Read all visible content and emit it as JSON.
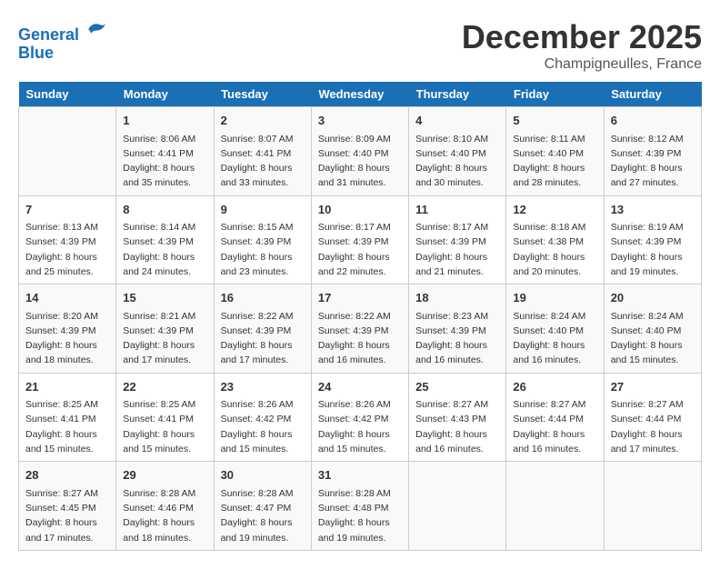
{
  "header": {
    "logo_line1": "General",
    "logo_line2": "Blue",
    "month": "December 2025",
    "location": "Champigneulles, France"
  },
  "days_of_week": [
    "Sunday",
    "Monday",
    "Tuesday",
    "Wednesday",
    "Thursday",
    "Friday",
    "Saturday"
  ],
  "weeks": [
    [
      {
        "day": "",
        "info": ""
      },
      {
        "day": "1",
        "info": "Sunrise: 8:06 AM\nSunset: 4:41 PM\nDaylight: 8 hours\nand 35 minutes."
      },
      {
        "day": "2",
        "info": "Sunrise: 8:07 AM\nSunset: 4:41 PM\nDaylight: 8 hours\nand 33 minutes."
      },
      {
        "day": "3",
        "info": "Sunrise: 8:09 AM\nSunset: 4:40 PM\nDaylight: 8 hours\nand 31 minutes."
      },
      {
        "day": "4",
        "info": "Sunrise: 8:10 AM\nSunset: 4:40 PM\nDaylight: 8 hours\nand 30 minutes."
      },
      {
        "day": "5",
        "info": "Sunrise: 8:11 AM\nSunset: 4:40 PM\nDaylight: 8 hours\nand 28 minutes."
      },
      {
        "day": "6",
        "info": "Sunrise: 8:12 AM\nSunset: 4:39 PM\nDaylight: 8 hours\nand 27 minutes."
      }
    ],
    [
      {
        "day": "7",
        "info": "Sunrise: 8:13 AM\nSunset: 4:39 PM\nDaylight: 8 hours\nand 25 minutes."
      },
      {
        "day": "8",
        "info": "Sunrise: 8:14 AM\nSunset: 4:39 PM\nDaylight: 8 hours\nand 24 minutes."
      },
      {
        "day": "9",
        "info": "Sunrise: 8:15 AM\nSunset: 4:39 PM\nDaylight: 8 hours\nand 23 minutes."
      },
      {
        "day": "10",
        "info": "Sunrise: 8:17 AM\nSunset: 4:39 PM\nDaylight: 8 hours\nand 22 minutes."
      },
      {
        "day": "11",
        "info": "Sunrise: 8:17 AM\nSunset: 4:39 PM\nDaylight: 8 hours\nand 21 minutes."
      },
      {
        "day": "12",
        "info": "Sunrise: 8:18 AM\nSunset: 4:38 PM\nDaylight: 8 hours\nand 20 minutes."
      },
      {
        "day": "13",
        "info": "Sunrise: 8:19 AM\nSunset: 4:39 PM\nDaylight: 8 hours\nand 19 minutes."
      }
    ],
    [
      {
        "day": "14",
        "info": "Sunrise: 8:20 AM\nSunset: 4:39 PM\nDaylight: 8 hours\nand 18 minutes."
      },
      {
        "day": "15",
        "info": "Sunrise: 8:21 AM\nSunset: 4:39 PM\nDaylight: 8 hours\nand 17 minutes."
      },
      {
        "day": "16",
        "info": "Sunrise: 8:22 AM\nSunset: 4:39 PM\nDaylight: 8 hours\nand 17 minutes."
      },
      {
        "day": "17",
        "info": "Sunrise: 8:22 AM\nSunset: 4:39 PM\nDaylight: 8 hours\nand 16 minutes."
      },
      {
        "day": "18",
        "info": "Sunrise: 8:23 AM\nSunset: 4:39 PM\nDaylight: 8 hours\nand 16 minutes."
      },
      {
        "day": "19",
        "info": "Sunrise: 8:24 AM\nSunset: 4:40 PM\nDaylight: 8 hours\nand 16 minutes."
      },
      {
        "day": "20",
        "info": "Sunrise: 8:24 AM\nSunset: 4:40 PM\nDaylight: 8 hours\nand 15 minutes."
      }
    ],
    [
      {
        "day": "21",
        "info": "Sunrise: 8:25 AM\nSunset: 4:41 PM\nDaylight: 8 hours\nand 15 minutes."
      },
      {
        "day": "22",
        "info": "Sunrise: 8:25 AM\nSunset: 4:41 PM\nDaylight: 8 hours\nand 15 minutes."
      },
      {
        "day": "23",
        "info": "Sunrise: 8:26 AM\nSunset: 4:42 PM\nDaylight: 8 hours\nand 15 minutes."
      },
      {
        "day": "24",
        "info": "Sunrise: 8:26 AM\nSunset: 4:42 PM\nDaylight: 8 hours\nand 15 minutes."
      },
      {
        "day": "25",
        "info": "Sunrise: 8:27 AM\nSunset: 4:43 PM\nDaylight: 8 hours\nand 16 minutes."
      },
      {
        "day": "26",
        "info": "Sunrise: 8:27 AM\nSunset: 4:44 PM\nDaylight: 8 hours\nand 16 minutes."
      },
      {
        "day": "27",
        "info": "Sunrise: 8:27 AM\nSunset: 4:44 PM\nDaylight: 8 hours\nand 17 minutes."
      }
    ],
    [
      {
        "day": "28",
        "info": "Sunrise: 8:27 AM\nSunset: 4:45 PM\nDaylight: 8 hours\nand 17 minutes."
      },
      {
        "day": "29",
        "info": "Sunrise: 8:28 AM\nSunset: 4:46 PM\nDaylight: 8 hours\nand 18 minutes."
      },
      {
        "day": "30",
        "info": "Sunrise: 8:28 AM\nSunset: 4:47 PM\nDaylight: 8 hours\nand 19 minutes."
      },
      {
        "day": "31",
        "info": "Sunrise: 8:28 AM\nSunset: 4:48 PM\nDaylight: 8 hours\nand 19 minutes."
      },
      {
        "day": "",
        "info": ""
      },
      {
        "day": "",
        "info": ""
      },
      {
        "day": "",
        "info": ""
      }
    ]
  ]
}
